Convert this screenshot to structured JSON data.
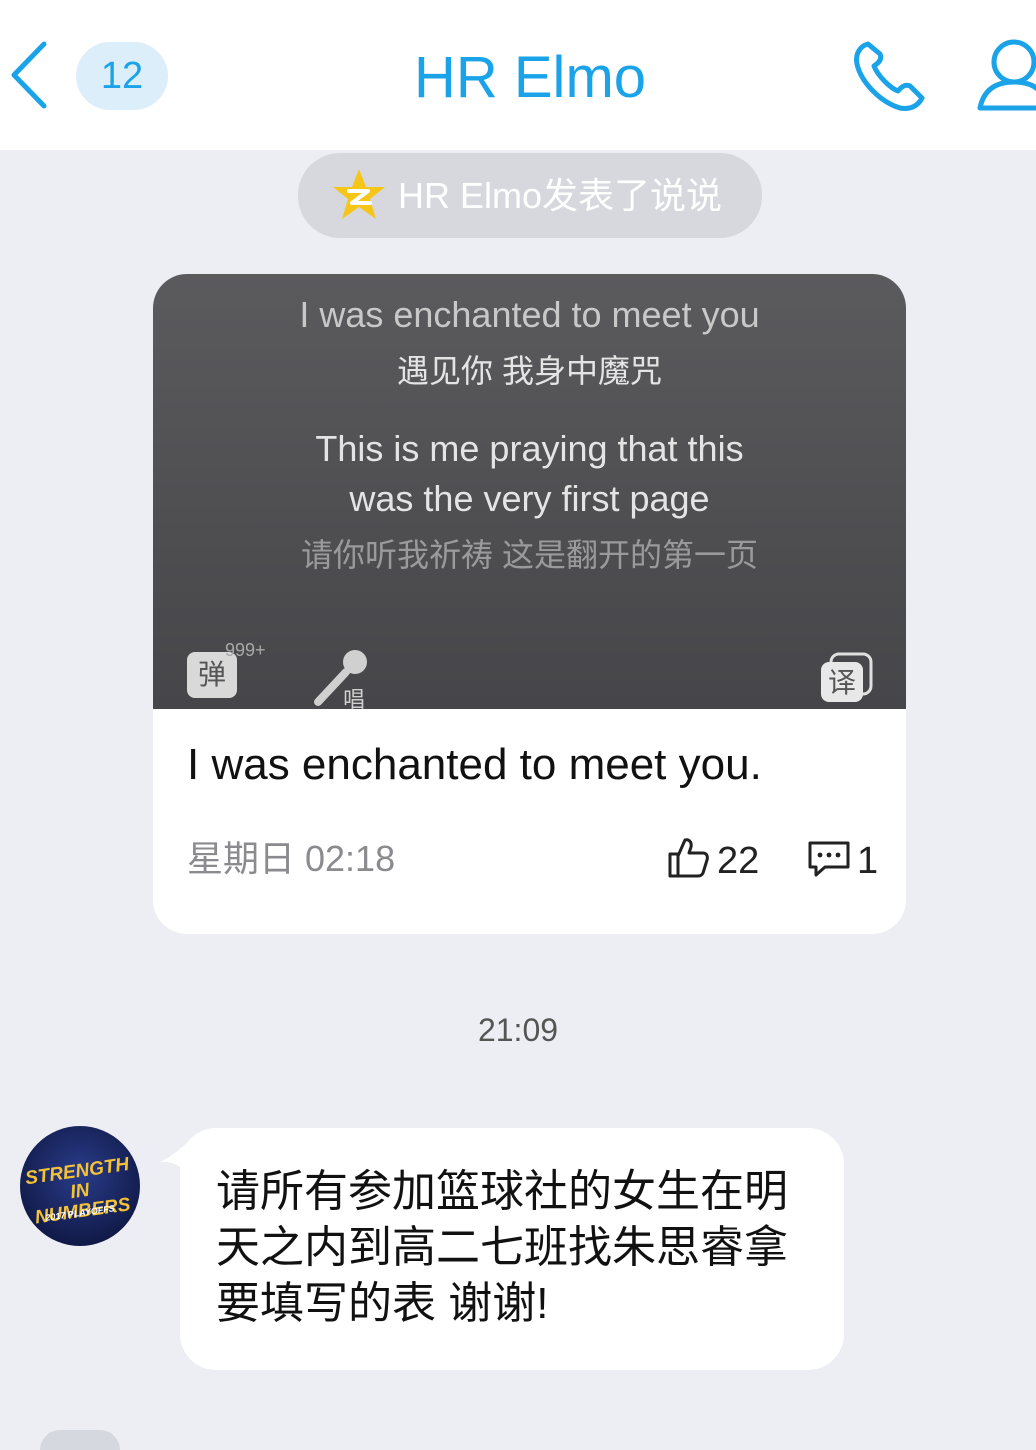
{
  "header": {
    "back_icon": "chevron-left-icon",
    "unread_count": "12",
    "title": "HR Elmo",
    "call_icon": "phone-icon",
    "profile_icon": "person-icon",
    "accent_color": "#1aa3e8"
  },
  "moment_notice": {
    "icon": "qzone-star-icon",
    "text": "HR Elmo发表了说说"
  },
  "post": {
    "cover": {
      "lyric_line_1": "I was enchanted to meet you",
      "lyric_line_2": "遇见你 我身中魔咒",
      "lyric_line_3": "This is me praying that this",
      "lyric_line_4": "was the very first page",
      "lyric_line_5": "请你听我祈祷 这是翻开的第一页",
      "danmu_label": "弹",
      "danmu_count": "999+",
      "sing_label": "唱",
      "translate_label": "译"
    },
    "caption": "I was enchanted to meet you.",
    "date": "星期日 02:18",
    "likes": "22",
    "comments": "1"
  },
  "timestamp": "21:09",
  "message": {
    "avatar_text_1": "STRENGTH",
    "avatar_text_2": "IN NUMBERS",
    "avatar_text_3": "2017 PLAYOFFS",
    "text": "请所有参加篮球社的女生在明天之内到高二七班找朱思睿拿要填写的表 谢谢!"
  }
}
